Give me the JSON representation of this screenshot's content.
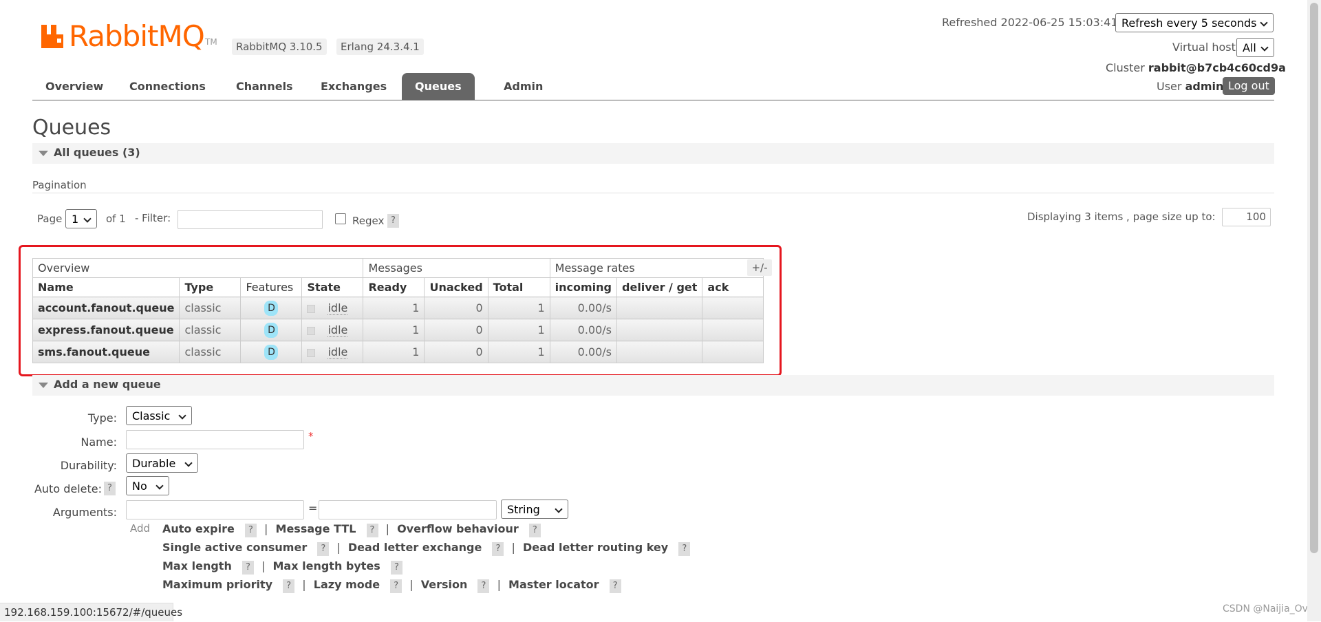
{
  "logo": {
    "word": "RabbitMQ",
    "tm": "TM"
  },
  "versions": {
    "rabbitmq": "RabbitMQ 3.10.5",
    "erlang": "Erlang 24.3.4.1"
  },
  "top_right": {
    "refreshed_label": "Refreshed 2022-06-25 15:03:41",
    "refresh_select": "Refresh every 5 seconds",
    "vhost_label": "Virtual host",
    "vhost_select": "All",
    "cluster_label": "Cluster",
    "cluster_value": "rabbit@b7cb4c60cd9a",
    "user_label": "User",
    "user_value": "admin",
    "logout": "Log out"
  },
  "nav": {
    "tabs": [
      "Overview",
      "Connections",
      "Channels",
      "Exchanges",
      "Queues",
      "Admin"
    ],
    "active": "Queues"
  },
  "page_title": "Queues",
  "all_queues": {
    "title": "All queues (3)",
    "pagination_label": "Pagination",
    "page_label": "Page",
    "page_value": "1",
    "of_label": "of 1",
    "filter_label": "- Filter:",
    "regex_label": "Regex",
    "q": "?",
    "displaying": "Displaying 3 items , page size up to:",
    "page_size": "100"
  },
  "table": {
    "groups": [
      "Overview",
      "Messages",
      "Message rates"
    ],
    "plusminus": "+/-",
    "headers": [
      "Name",
      "Type",
      "Features",
      "State",
      "Ready",
      "Unacked",
      "Total",
      "incoming",
      "deliver / get",
      "ack"
    ],
    "rows": [
      {
        "name": "account.fanout.queue",
        "type": "classic",
        "feature": "D",
        "state": "idle",
        "ready": "1",
        "unacked": "0",
        "total": "1",
        "incoming": "0.00/s",
        "deliver": "",
        "ack": ""
      },
      {
        "name": "express.fanout.queue",
        "type": "classic",
        "feature": "D",
        "state": "idle",
        "ready": "1",
        "unacked": "0",
        "total": "1",
        "incoming": "0.00/s",
        "deliver": "",
        "ack": ""
      },
      {
        "name": "sms.fanout.queue",
        "type": "classic",
        "feature": "D",
        "state": "idle",
        "ready": "1",
        "unacked": "0",
        "total": "1",
        "incoming": "0.00/s",
        "deliver": "",
        "ack": ""
      }
    ]
  },
  "add_queue": {
    "title": "Add a new queue",
    "type_label": "Type:",
    "type_value": "Classic",
    "name_label": "Name:",
    "required": "*",
    "durability_label": "Durability:",
    "durability_value": "Durable",
    "autodelete_label": "Auto delete:",
    "autodelete_value": "No",
    "arguments_label": "Arguments:",
    "equals": "=",
    "arg_type": "String",
    "add_label": "Add",
    "arg_rows": [
      [
        "Auto expire",
        "Message TTL",
        "Overflow behaviour"
      ],
      [
        "Single active consumer",
        "Dead letter exchange",
        "Dead letter routing key"
      ],
      [
        "Max length",
        "Max length bytes"
      ],
      [
        "Maximum priority",
        "Lazy mode",
        "Version",
        "Master locator"
      ]
    ]
  },
  "status_bar": "192.168.159.100:15672/#/queues",
  "watermark": "CSDN @Naijia_OvO",
  "colors": {
    "brand": "#ff6600",
    "tab_active": "#666666",
    "highlight": "#e5161e",
    "durable_badge": "#9ee4f8"
  }
}
